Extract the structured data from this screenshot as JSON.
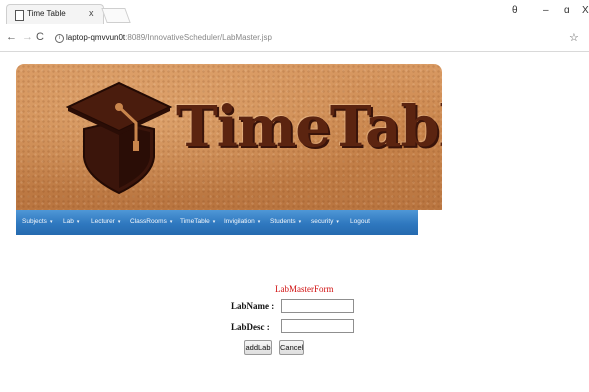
{
  "browser": {
    "tab_title": "Time Table",
    "tab_close": "x",
    "url_host": "laptop-qmvvun0t",
    "url_rest": ":8089/InnovativeScheduler/LabMaster.jsp",
    "window_controls": {
      "account": "θ",
      "minimize": "–",
      "maximize": "ɑ",
      "close": "X"
    }
  },
  "banner": {
    "title": "TimeTable"
  },
  "menu": {
    "items": [
      {
        "label": "Subjects"
      },
      {
        "label": "Lab"
      },
      {
        "label": "Lecturer"
      },
      {
        "label": "ClassRooms"
      },
      {
        "label": "TimeTable"
      },
      {
        "label": "Invigilation"
      },
      {
        "label": "Students"
      },
      {
        "label": "security"
      },
      {
        "label": "Logout"
      }
    ],
    "caret": "▾"
  },
  "form": {
    "title": "LabMasterForm",
    "lab_name_label": "LabName :",
    "lab_desc_label": "LabDesc :",
    "lab_name_value": "",
    "lab_desc_value": "",
    "add_button": "addLab",
    "cancel_button": "Cancel"
  },
  "colors": {
    "menu_bar": "#2f78bf",
    "form_title": "#d01010",
    "banner_text": "#5b2410"
  }
}
